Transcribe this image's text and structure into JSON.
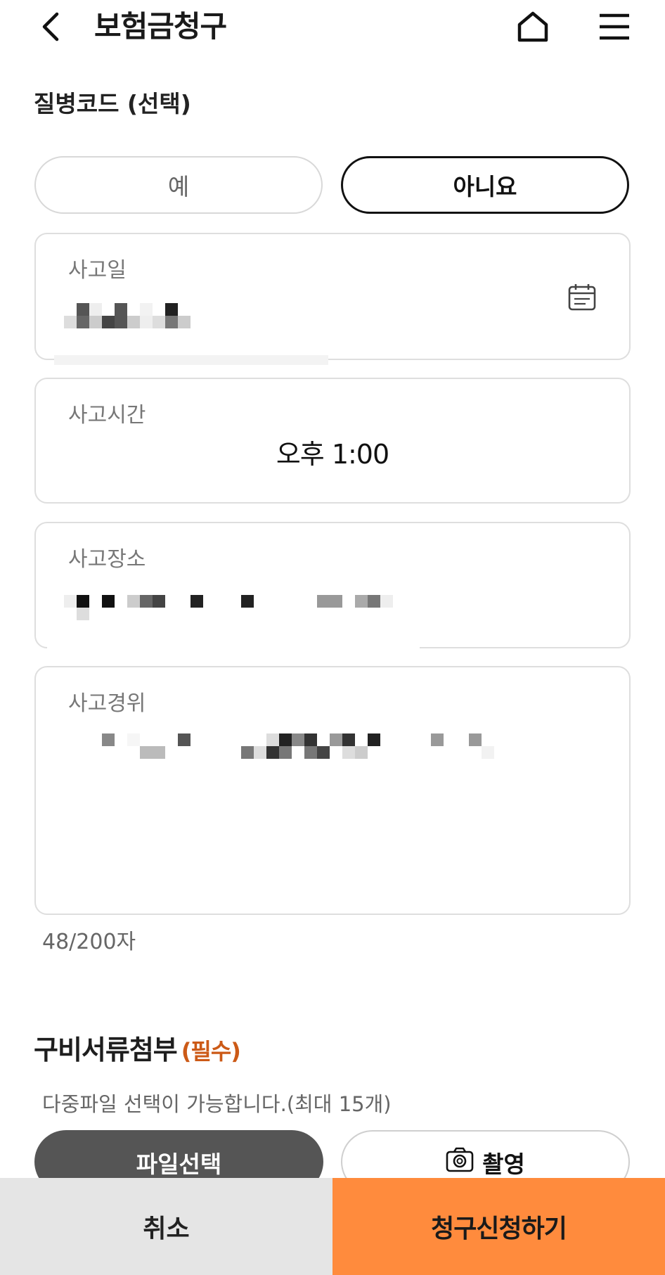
{
  "header": {
    "title": "보험금청구",
    "back_icon": "chevron-left-icon",
    "home_icon": "home-icon",
    "menu_icon": "hamburger-menu-icon"
  },
  "disease_code": {
    "title": "질병코드 (선택)",
    "yes_label": "예",
    "no_label": "아니요",
    "selected": "아니요"
  },
  "accident_date": {
    "label": "사고일",
    "icon": "calendar-icon"
  },
  "accident_time": {
    "label": "사고시간",
    "value": "오후 1:00"
  },
  "accident_place": {
    "label": "사고장소"
  },
  "accident_desc": {
    "label": "사고경위",
    "char_count": "48/200자"
  },
  "attachments": {
    "title": "구비서류첨부",
    "required_tag": "(필수)",
    "hint": "다중파일 선택이 가능합니다.(최대 15개)",
    "file_button": "파일선택",
    "shoot_button": "촬영",
    "shoot_icon": "camera-icon"
  },
  "footer": {
    "cancel_label": "취소",
    "submit_label": "청구신청하기",
    "submit_color": "#ff8b3d",
    "cancel_color": "#e5e5e5"
  }
}
